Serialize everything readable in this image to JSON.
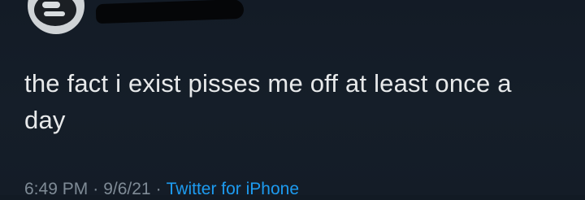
{
  "tweet": {
    "text": "the fact i exist pisses me off at least once a day",
    "time": "6:49 PM",
    "date": "9/6/21",
    "separator": "·",
    "source": "Twitter for iPhone"
  },
  "colors": {
    "background": "#121a24",
    "text": "#e7e9ea",
    "meta": "#7f8b96",
    "link": "#1d9bf0"
  }
}
